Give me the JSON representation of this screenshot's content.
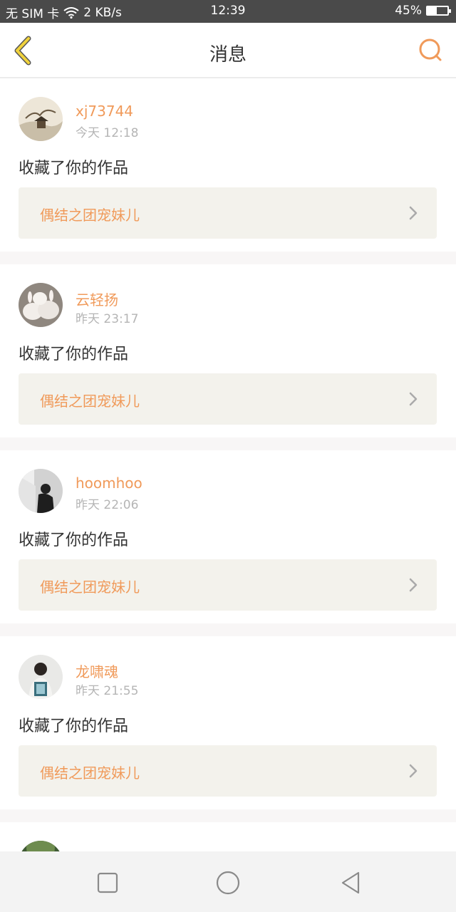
{
  "status_bar": {
    "carrier": "无 SIM 卡",
    "speed": "2 KB/s",
    "time": "12:39",
    "battery_percent": "45%",
    "battery_level": 0.45
  },
  "header": {
    "title": "消息",
    "back_icon": "chevron-left-icon",
    "search_icon": "search-icon"
  },
  "messages": [
    {
      "username": "xj73744",
      "time": "今天 12:18",
      "action": "收藏了你的作品",
      "work_title": "偶结之团宠妹儿"
    },
    {
      "username": "云轻扬",
      "time": "昨天 23:17",
      "action": "收藏了你的作品",
      "work_title": "偶结之团宠妹儿"
    },
    {
      "username": "hoomhoo",
      "time": "昨天 22:06",
      "action": "收藏了你的作品",
      "work_title": "偶结之团宠妹儿"
    },
    {
      "username": "龙啸魂",
      "time": "昨天 21:55",
      "action": "收藏了你的作品",
      "work_title": "偶结之团宠妹儿"
    }
  ],
  "colors": {
    "accent": "#f09a5a",
    "back_icon": "#f0d23c",
    "status_bar": "#4a4a4a",
    "work_box": "#f3f2ec"
  }
}
